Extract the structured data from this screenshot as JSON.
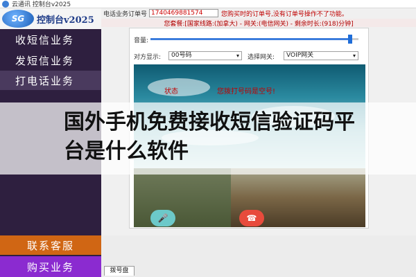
{
  "window": {
    "title": "云通讯 控制台v2025"
  },
  "logo": {
    "badge": "SG",
    "text": "控制台v2025"
  },
  "sidebar": {
    "items": [
      {
        "label": "收短信业务"
      },
      {
        "label": "发短信业务"
      },
      {
        "label": "打电话业务"
      }
    ],
    "contact_label": "联系客服",
    "buy_label": "购买业务",
    "colors": {
      "background": "#2e1f3f",
      "contact": "#d06614",
      "buy": "#8b2bd0"
    }
  },
  "order": {
    "label": "电话业务订单号",
    "value": "1740469881574",
    "hint": "您购买时的订单号,没有订单号操作不了功能。"
  },
  "package_info": "您套餐:[国家线路:(加拿大) - 网关:(电信网关) - 剩余时长:(918)分钟]",
  "volume": {
    "label": "音量:",
    "level_percent": 96
  },
  "caller": {
    "label": "对方显示:",
    "value": "00号码"
  },
  "gateway": {
    "label": "选择网关:",
    "value": "VOIP网关"
  },
  "call_panel": {
    "status": "状态",
    "dial_message": "您拨打号码是空号!"
  },
  "tabs": {
    "dialpad": "拨号盘"
  },
  "overlay": {
    "title": "国外手机免费接收短信验证码平台是什么软件"
  }
}
